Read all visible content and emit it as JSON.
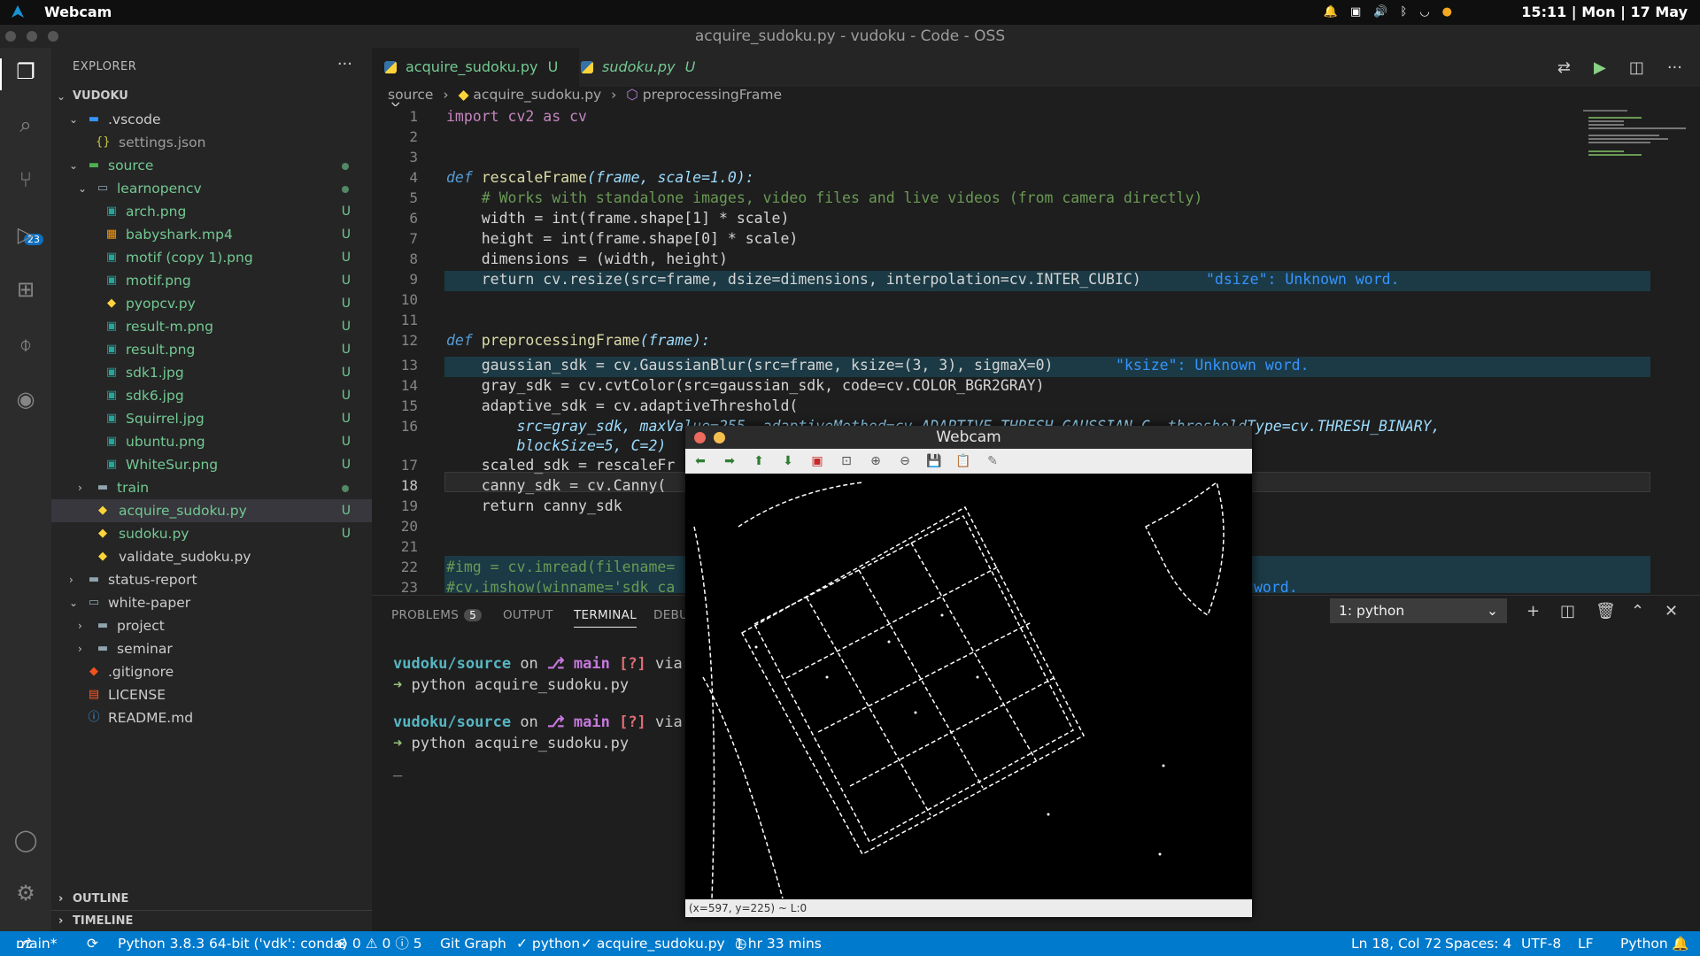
{
  "system_bar": {
    "app_name": "Webcam",
    "clock": "15:11 | Mon | 17 May"
  },
  "window_title": "acquire_sudoku.py - vudoku - Code - OSS",
  "activity_bar": {
    "scm_badge": "23"
  },
  "explorer": {
    "header": "EXPLORER",
    "root": "VUDOKU",
    "items": [
      {
        "label": ".vscode",
        "status": ""
      },
      {
        "label": "settings.json",
        "status": ""
      },
      {
        "label": "source",
        "status": ""
      },
      {
        "label": "learnopencv",
        "status": ""
      },
      {
        "label": "arch.png",
        "status": "U"
      },
      {
        "label": "babyshark.mp4",
        "status": "U"
      },
      {
        "label": "motif (copy 1).png",
        "status": "U"
      },
      {
        "label": "motif.png",
        "status": "U"
      },
      {
        "label": "pyopcv.py",
        "status": "U"
      },
      {
        "label": "result-m.png",
        "status": "U"
      },
      {
        "label": "result.png",
        "status": "U"
      },
      {
        "label": "sdk1.jpg",
        "status": "U"
      },
      {
        "label": "sdk6.jpg",
        "status": "U"
      },
      {
        "label": "Squirrel.jpg",
        "status": "U"
      },
      {
        "label": "ubuntu.png",
        "status": "U"
      },
      {
        "label": "WhiteSur.png",
        "status": "U"
      },
      {
        "label": "train",
        "status": ""
      },
      {
        "label": "acquire_sudoku.py",
        "status": "U"
      },
      {
        "label": "sudoku.py",
        "status": "U"
      },
      {
        "label": "validate_sudoku.py",
        "status": ""
      },
      {
        "label": "status-report",
        "status": ""
      },
      {
        "label": "white-paper",
        "status": ""
      },
      {
        "label": "project",
        "status": ""
      },
      {
        "label": "seminar",
        "status": ""
      },
      {
        "label": ".gitignore",
        "status": ""
      },
      {
        "label": "LICENSE",
        "status": ""
      },
      {
        "label": "README.md",
        "status": ""
      }
    ],
    "outline": "OUTLINE",
    "timeline": "TIMELINE"
  },
  "tabs": [
    {
      "label": "acquire_sudoku.py",
      "status": "U",
      "close": "×"
    },
    {
      "label": "sudoku.py",
      "status": "U"
    }
  ],
  "breadcrumb": {
    "part1": "source",
    "part2": "acquire_sudoku.py",
    "part3": "preprocessingFrame"
  },
  "code": {
    "lines": [
      "1",
      "2",
      "3",
      "4",
      "5",
      "6",
      "7",
      "8",
      "9",
      "10",
      "11",
      "12",
      "13",
      "14",
      "15",
      "16",
      "17",
      "18",
      "19",
      "20",
      "21",
      "22",
      "23"
    ],
    "l1": "import cv2 as cv",
    "l4_def": "def",
    "l4_name": "rescaleFrame",
    "l4_args": "(frame, scale=1.0):",
    "l5": "    # Works with standalone images, video files and live videos (from camera directly)",
    "l6": "    width = int(frame.shape[1] * scale)",
    "l7": "    height = int(frame.shape[0] * scale)",
    "l8": "    dimensions = (width, height)",
    "l9": "    return cv.resize(src=frame, dsize=dimensions, interpolation=cv.INTER_CUBIC)",
    "l9_warn": "\"dsize\": Unknown word.",
    "l12_def": "def",
    "l12_name": "preprocessingFrame",
    "l12_args": "(frame):",
    "l13": "    gaussian_sdk = cv.GaussianBlur(src=frame, ksize=(3, 3), sigmaX=0)",
    "l13_warn": "\"ksize\": Unknown word.",
    "l14": "    gray_sdk = cv.cvtColor(src=gaussian_sdk, code=cv.COLOR_BGR2GRAY)",
    "l15": "    adaptive_sdk = cv.adaptiveThreshold(",
    "l16a": "        src=gray_sdk, maxValue=255, adaptiveMethod=cv.ADAPTIVE_THRESH_GAUSSIAN_C, thresholdType=cv.THRESH_BINARY,",
    "l16b": "        blockSize=5, C=2)",
    "l17": "    scaled_sdk = rescaleFr",
    "l18": "    canny_sdk = cv.Canny(",
    "l19": "    return canny_sdk",
    "l22": "#img = cv.imread(filename=",
    "l23": "#cv.imshow(winname='sdk_ca",
    "l23_tail": "word."
  },
  "panel": {
    "tabs": [
      "PROBLEMS",
      "OUTPUT",
      "TERMINAL",
      "DEBU"
    ],
    "problems_count": "5",
    "terminal_select": "1: python",
    "prompt_path": "vudoku/source",
    "prompt_on": "on",
    "prompt_branch": "main",
    "prompt_flag": "[?]",
    "prompt_via": "via",
    "command": "python acquire_sudoku.py",
    "cursor": "_"
  },
  "webcam": {
    "title": "Webcam",
    "status": "(x=597, y=225) ~ L:0"
  },
  "statusbar": {
    "branch": "main*",
    "python": "Python 3.8.3 64-bit ('vdk': conda)",
    "errors": "⊗ 0 ⚠ 0 ⓘ 5",
    "git_graph": "Git Graph",
    "check_python": "✓ python",
    "check_file": "✓ acquire_sudoku.py",
    "time": "1 hr 33 mins",
    "position": "Ln 18, Col 72",
    "spaces": "Spaces: 4",
    "encoding": "UTF-8",
    "eol": "LF",
    "language": "Python"
  }
}
